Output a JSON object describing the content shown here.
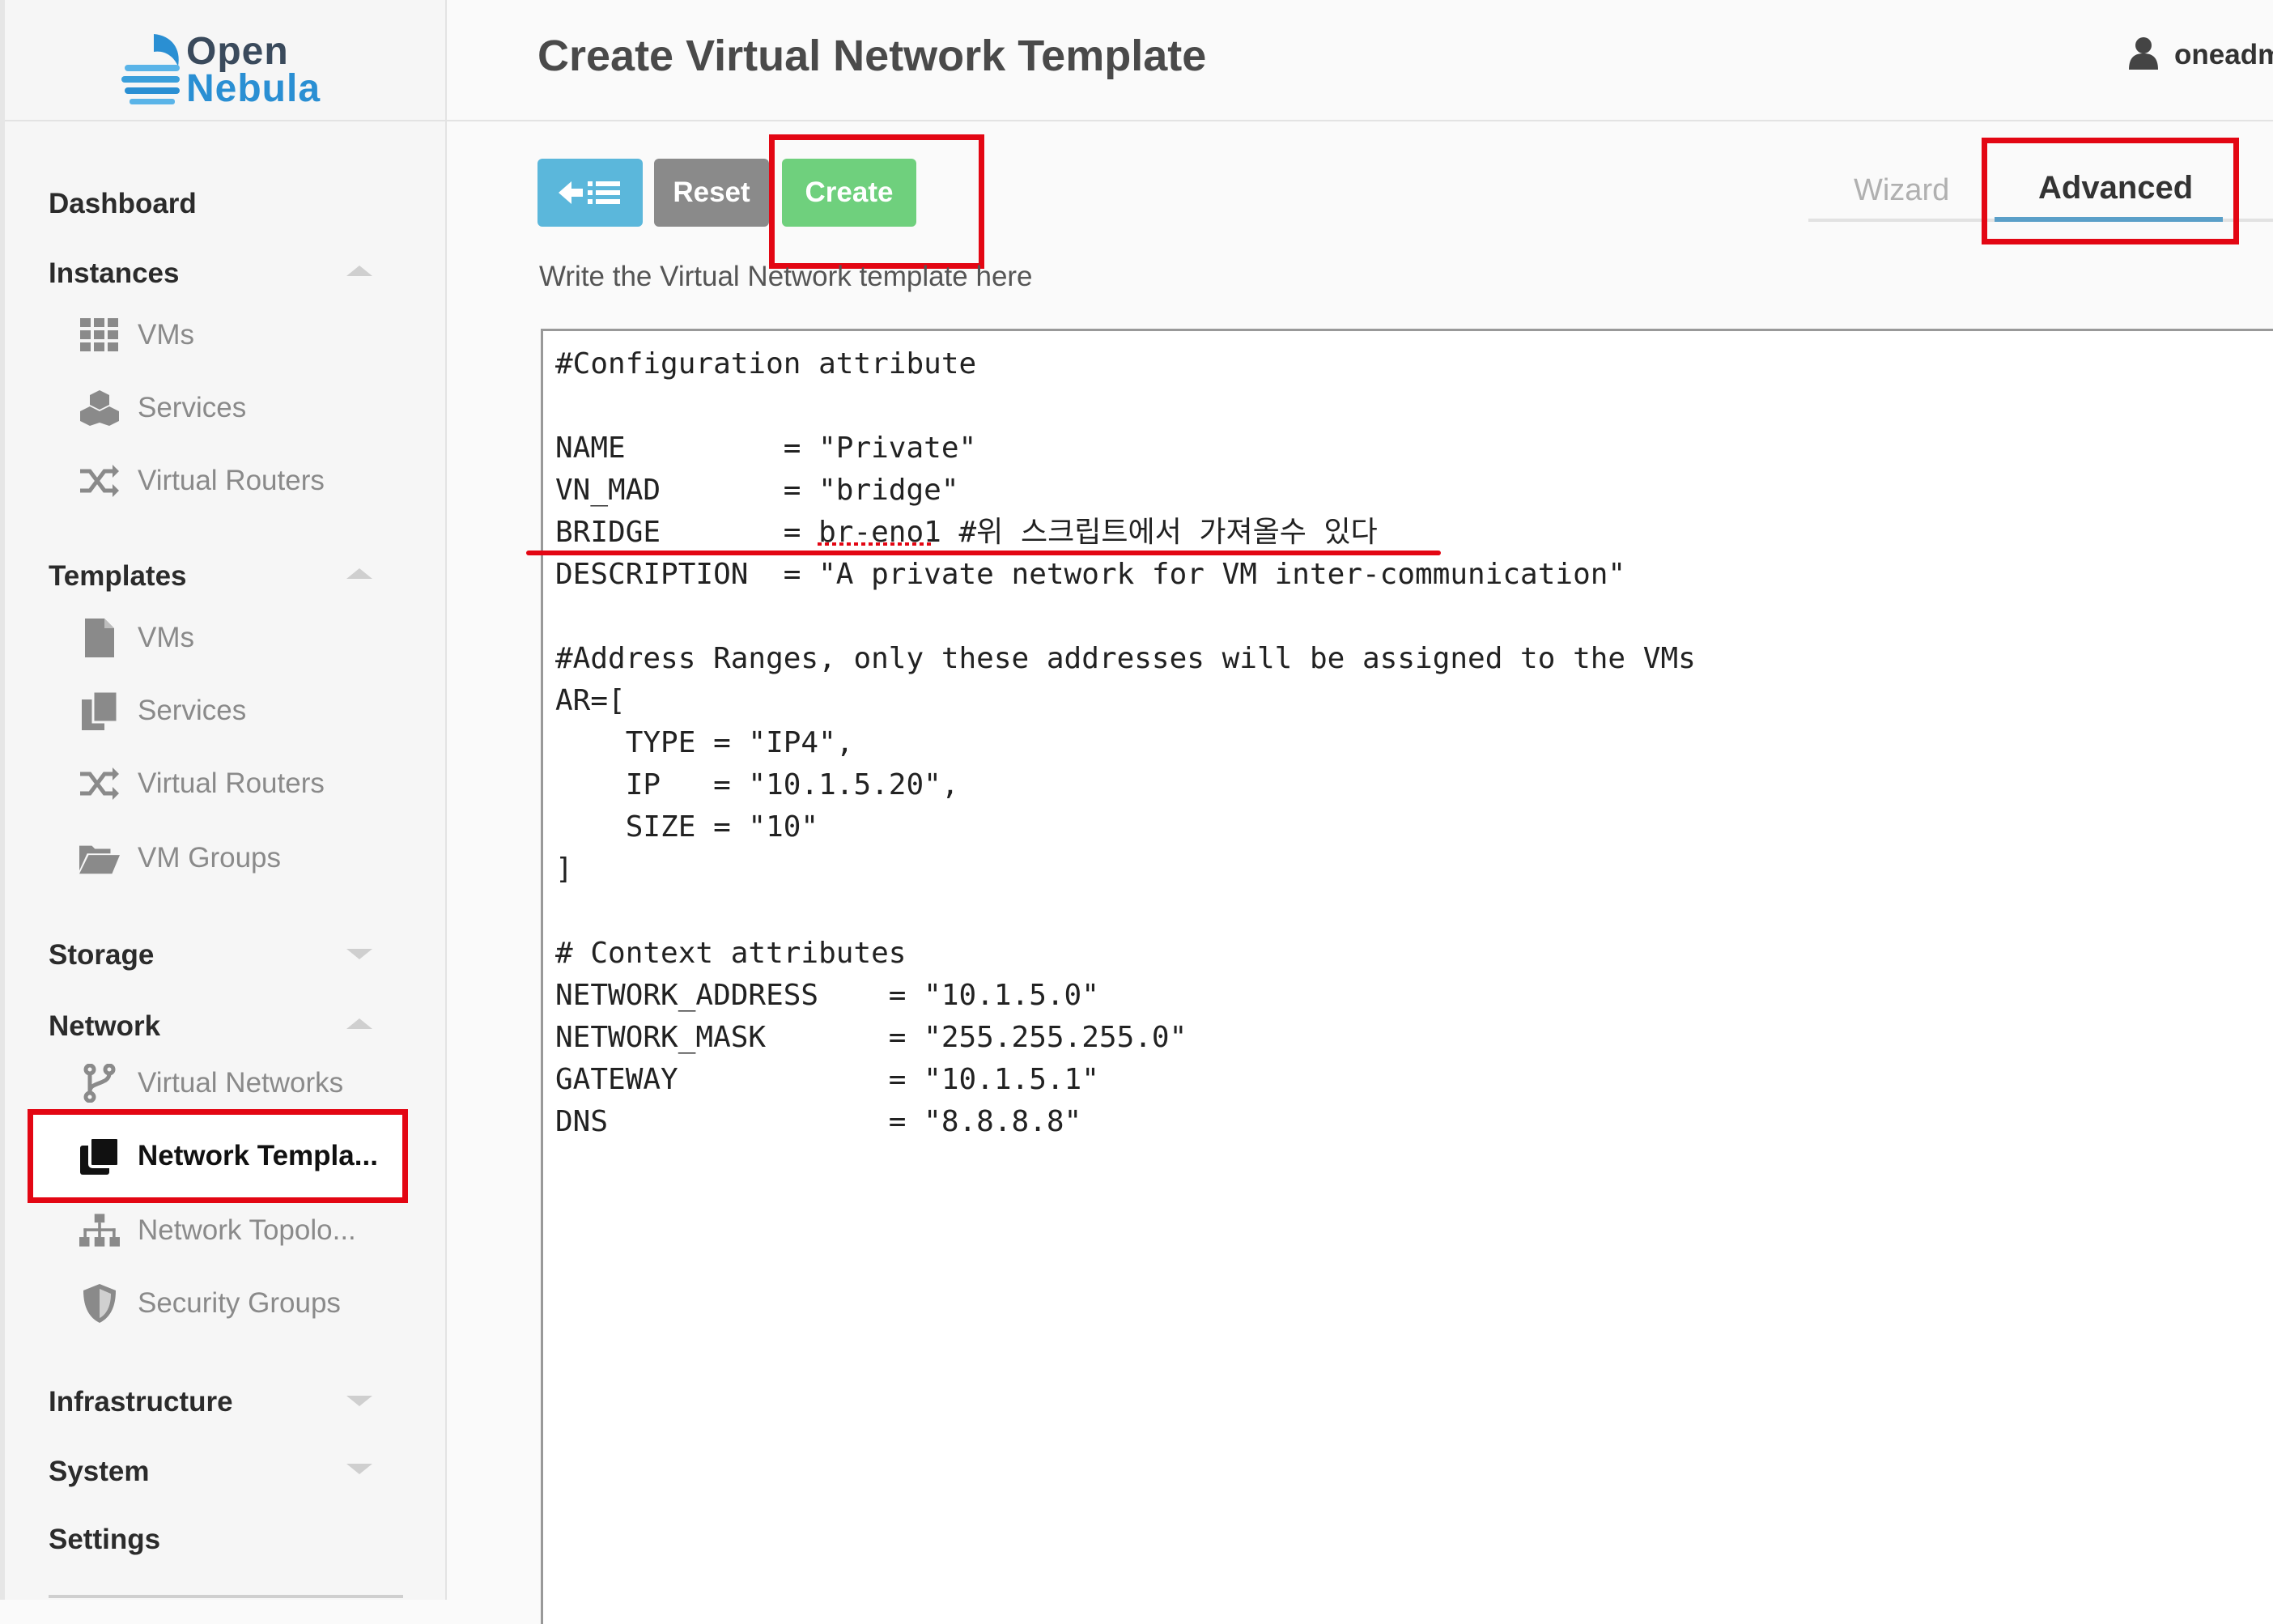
{
  "app": {
    "logo_top": "Open",
    "logo_bottom": "Nebula"
  },
  "header": {
    "title": "Create Virtual Network Template",
    "user": "oneadm"
  },
  "sidebar": {
    "dashboard": "Dashboard",
    "instances": {
      "label": "Instances",
      "items": [
        "VMs",
        "Services",
        "Virtual Routers"
      ]
    },
    "templates": {
      "label": "Templates",
      "items": [
        "VMs",
        "Services",
        "Virtual Routers",
        "VM Groups"
      ]
    },
    "storage": "Storage",
    "network": {
      "label": "Network",
      "items": [
        "Virtual Networks",
        "Network Templa...",
        "Network Topolo...",
        "Security Groups"
      ]
    },
    "infrastructure": "Infrastructure",
    "system": "System",
    "settings": "Settings"
  },
  "toolbar": {
    "reset_label": "Reset",
    "create_label": "Create"
  },
  "tabs": {
    "wizard": "Wizard",
    "advanced": "Advanced",
    "active": "Advanced"
  },
  "form": {
    "help_text": "Write the Virtual Network template here",
    "template_text": "#Configuration attribute\n\nNAME         = \"Private\"\nVN_MAD       = \"bridge\"\nBRIDGE       = br-eno1 #위 스크립트에서 가져올수 있다\nDESCRIPTION  = \"A private network for VM inter-communication\"\n\n#Address Ranges, only these addresses will be assigned to the VMs\nAR=[\n    TYPE = \"IP4\",\n    IP   = \"10.1.5.20\",\n    SIZE = \"10\"\n]\n\n# Context attributes\nNETWORK_ADDRESS    = \"10.1.5.0\"\nNETWORK_MASK       = \"255.255.255.0\"\nGATEWAY            = \"10.1.5.1\"\nDNS                = \"8.8.8.8\""
  },
  "colors": {
    "highlight": "#e30613",
    "create_button": "#6fd07d",
    "back_button": "#5bb7db",
    "reset_button": "#8a8a8a",
    "tab_active_underline": "#5a9fc8",
    "logo_blue": "#2a8fd3"
  }
}
